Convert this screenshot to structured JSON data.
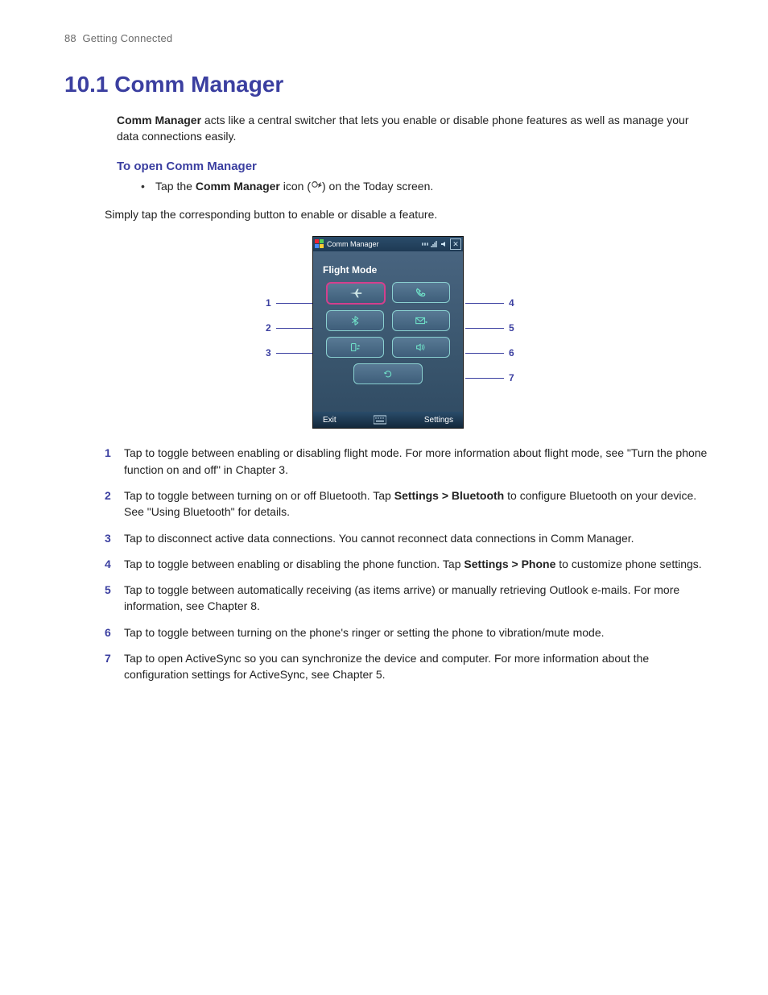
{
  "header": {
    "page_number": "88",
    "chapter": "Getting Connected"
  },
  "title": "10.1  Comm Manager",
  "intro": {
    "lead_bold": "Comm Manager",
    "rest": " acts like a central switcher that lets you enable or disable phone features as well as manage your data connections easily."
  },
  "subheading": "To open Comm Manager",
  "bullet": {
    "pre": "Tap the ",
    "bold": "Comm Manager",
    "post": " icon (",
    "tail": ") on the Today screen."
  },
  "body_text": "Simply tap the corresponding button to enable or disable a feature.",
  "screenshot": {
    "titlebar": "Comm Manager",
    "flight_label": "Flight Mode",
    "soft_left": "Exit",
    "soft_right": "Settings"
  },
  "callouts_left": [
    "1",
    "2",
    "3"
  ],
  "callouts_right": [
    "4",
    "5",
    "6",
    "7"
  ],
  "descriptions": [
    {
      "n": "1",
      "text": "Tap to toggle between enabling or disabling flight mode. For more information about flight mode, see \"Turn the phone function on and off\" in Chapter 3."
    },
    {
      "n": "2",
      "pre": "Tap to toggle between turning on or off Bluetooth. Tap ",
      "bold": "Settings > Bluetooth",
      "post": " to configure Bluetooth on your device. See \"Using Bluetooth\" for details."
    },
    {
      "n": "3",
      "text": "Tap to disconnect active data connections. You cannot reconnect data connections in Comm Manager."
    },
    {
      "n": "4",
      "pre": "Tap to toggle between enabling or disabling the phone function. Tap ",
      "bold": "Settings > Phone",
      "post": " to customize phone settings."
    },
    {
      "n": "5",
      "text": "Tap to toggle between automatically receiving (as items arrive) or manually retrieving Outlook e-mails. For more information, see Chapter 8."
    },
    {
      "n": "6",
      "text": "Tap to toggle between turning on the phone's ringer or setting the phone to vibration/mute mode."
    },
    {
      "n": "7",
      "text": "Tap to open ActiveSync so you can synchronize the device and computer. For more information about the configuration settings for ActiveSync, see Chapter 5."
    }
  ]
}
